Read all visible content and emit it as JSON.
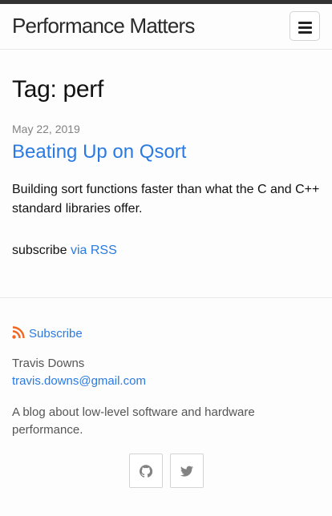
{
  "header": {
    "site_title": "Performance Matters",
    "menu_icon": "hamburger-menu-icon"
  },
  "page": {
    "heading": "Tag: perf"
  },
  "posts": [
    {
      "date": "May 22, 2019",
      "title": "Beating Up on Qsort",
      "excerpt": "Building sort functions faster than what the C and C++ standard libraries offer."
    }
  ],
  "rss": {
    "prefix": "subscribe",
    "link_label": "via RSS"
  },
  "footer": {
    "subscribe_label": "Subscribe",
    "author_name": "Travis Downs",
    "author_email": "travis.downs@gmail.com",
    "description": "A blog about low-level software and hardware performance.",
    "social": [
      {
        "icon": "github-icon"
      },
      {
        "icon": "twitter-icon"
      }
    ]
  },
  "colors": {
    "link": "#2a7ae2",
    "rss_orange": "#f26522",
    "top_bar": "#333333",
    "muted_text": "#828282"
  }
}
